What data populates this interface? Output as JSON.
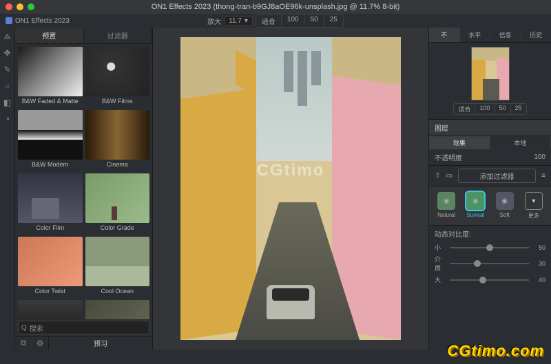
{
  "titlebar": {
    "title": "ON1 Effects 2023 (thong-tran-b9GJ8aOE96k-unsplash.jpg @ 11.7% 8-bit)",
    "app_tab": "ON1 Effects 2023"
  },
  "zoom": {
    "label": "放大",
    "value": "11.7",
    "dropdown_icon": "▾",
    "fit": "适合",
    "p100": "100",
    "p50": "50",
    "p25": "25"
  },
  "left": {
    "tab_presets": "预置",
    "tab_filters": "过滤器",
    "presets": [
      {
        "label": "B&W Faded & Matte",
        "cls": "th-bwf"
      },
      {
        "label": "B&W Films",
        "cls": "th-bwfilm"
      },
      {
        "label": "B&W Modern",
        "cls": "th-bwm"
      },
      {
        "label": "Cinema",
        "cls": "th-cin"
      },
      {
        "label": "Color Film",
        "cls": "th-cf"
      },
      {
        "label": "Color Grade",
        "cls": "th-cg"
      },
      {
        "label": "Color Twist",
        "cls": "th-ct"
      },
      {
        "label": "Cool Ocean",
        "cls": "th-co"
      },
      {
        "label": "",
        "cls": "th-x1"
      },
      {
        "label": "",
        "cls": "th-x2"
      }
    ],
    "search_icon": "Q",
    "search_placeholder": "搜索",
    "preview_btn": "预习"
  },
  "right": {
    "tabs": {
      "t1": "不",
      "t2": "水平",
      "t3": "信息",
      "t4": "历史"
    },
    "nav_fit": {
      "fit": "适合",
      "p100": "100",
      "p50": "50",
      "p25": "25"
    },
    "layers_hdr": "图层",
    "subtabs": {
      "effects": "效果",
      "local": "本地"
    },
    "opacity_label": "不透明度",
    "opacity_value": "100",
    "add_filter": "添加过滤器",
    "filter_presets": {
      "natural": "Natural",
      "surreal": "Surreal",
      "soft": "Soft",
      "more": "更多"
    },
    "contrast_hdr": "动态对比度:",
    "sliders": [
      {
        "label": "小",
        "value": "50",
        "pos": 50
      },
      {
        "label": "介质",
        "value": "30",
        "pos": 35
      },
      {
        "label": "大",
        "value": "40",
        "pos": 42
      }
    ]
  },
  "watermarks": {
    "viewport": "CGtimo",
    "page": "CGtimo.com"
  }
}
